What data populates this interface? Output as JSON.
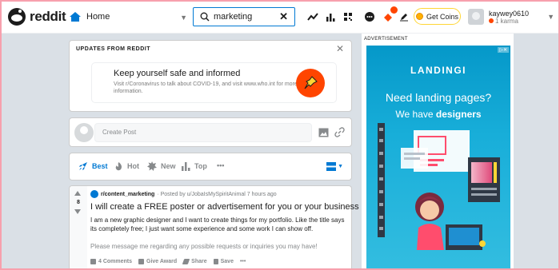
{
  "header": {
    "logo_text": "reddit",
    "home_label": "Home",
    "search_value": "marketing",
    "coins_label": "Get Coins",
    "username": "kaywey0610",
    "karma": "1 karma"
  },
  "updates": {
    "title": "UPDATES FROM REDDIT",
    "headline": "Keep yourself safe and informed",
    "body": "Visit r/Coronavirus to talk about COVID-19, and visit www.who.int for more information."
  },
  "create_post": {
    "placeholder": "Create Post"
  },
  "sort": {
    "items": [
      {
        "label": "Best"
      },
      {
        "label": "Hot"
      },
      {
        "label": "New"
      },
      {
        "label": "Top"
      }
    ],
    "more": "•••"
  },
  "post": {
    "votes": "8",
    "subreddit": "r/content_marketing",
    "meta": "· Posted by u/JobaIsMySpiritAnimal 7 hours ago",
    "title": "I will create a FREE poster or advertisement for you or your business",
    "body1": "I am a new graphic designer and I want to create things for my portfolio. Like the title says its completely free; I just want some experience and some work I can show off.",
    "body2": "Please message me regarding any possible requests or inquiries you may have!",
    "actions": {
      "comments": "4 Comments",
      "award": "Give Award",
      "share": "Share",
      "save": "Save",
      "more": "•••"
    }
  },
  "ad": {
    "label": "ADVERTISEMENT",
    "brand": "LANDINGI",
    "headline": "Need landing pages?",
    "subline_prefix": "We have ",
    "subline_bold": "designers"
  },
  "colors": {
    "accent": "#0079d3",
    "orangered": "#ff4500",
    "background": "#dae0e6",
    "ad_bg": "#18aed9"
  }
}
